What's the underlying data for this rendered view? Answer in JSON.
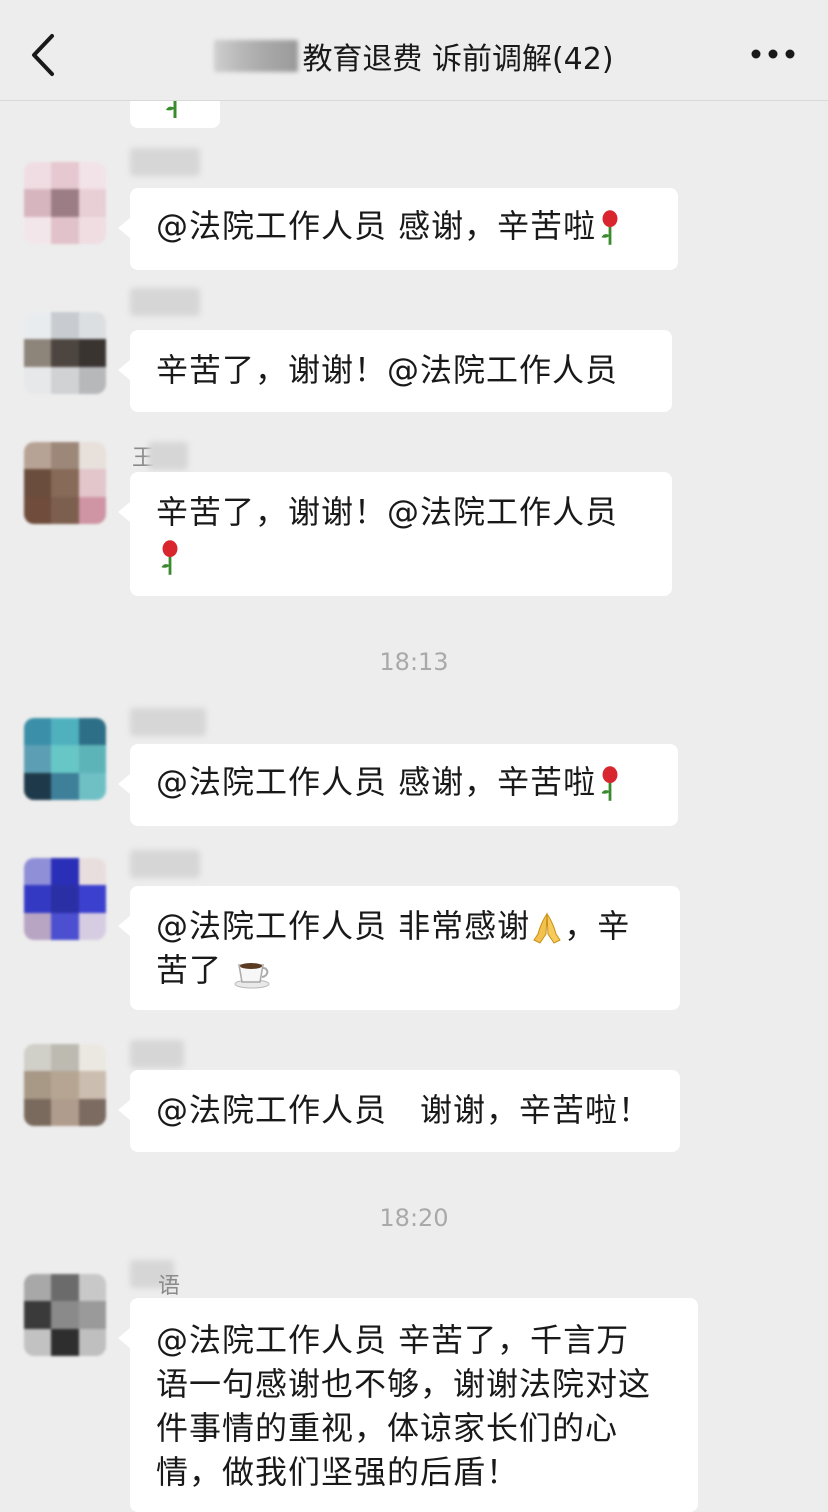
{
  "header": {
    "title": "教育退费 诉前调解(42)",
    "back_icon": "chevron-left-icon",
    "more_icon": "more-dots-icon"
  },
  "timestamps": [
    "18:13",
    "18:20"
  ],
  "messages": [
    {
      "text": "",
      "emoji": "rose-icon"
    },
    {
      "text": "@法院工作人员 感谢，辛苦啦",
      "emoji": "rose-icon"
    },
    {
      "text": "辛苦了，谢谢！@法院工作人员"
    },
    {
      "nickname": "王",
      "text": "辛苦了，谢谢！@法院工作人员",
      "emoji": "rose-icon"
    },
    {
      "text": "@法院工作人员 感谢，辛苦啦",
      "emoji": "rose-icon"
    },
    {
      "text_a": "@法院工作人员 非常感谢",
      "emoji_a": "praying-hands-icon",
      "text_b": "，辛",
      "text_c": "苦了",
      "emoji_b": "coffee-icon"
    },
    {
      "text": "@法院工作人员　谢谢，辛苦啦！"
    },
    {
      "nickname": "语",
      "lines": [
        "@法院工作人员 辛苦了，千言万",
        "语一句感谢也不够，谢谢法院对这",
        "件事情的重视，体谅家长们的心",
        "情，做我们坚强的后盾！"
      ]
    }
  ],
  "colors": {
    "background": "#ededed",
    "bubble": "#ffffff",
    "text": "#191919",
    "timestamp": "#a9a9a9"
  }
}
